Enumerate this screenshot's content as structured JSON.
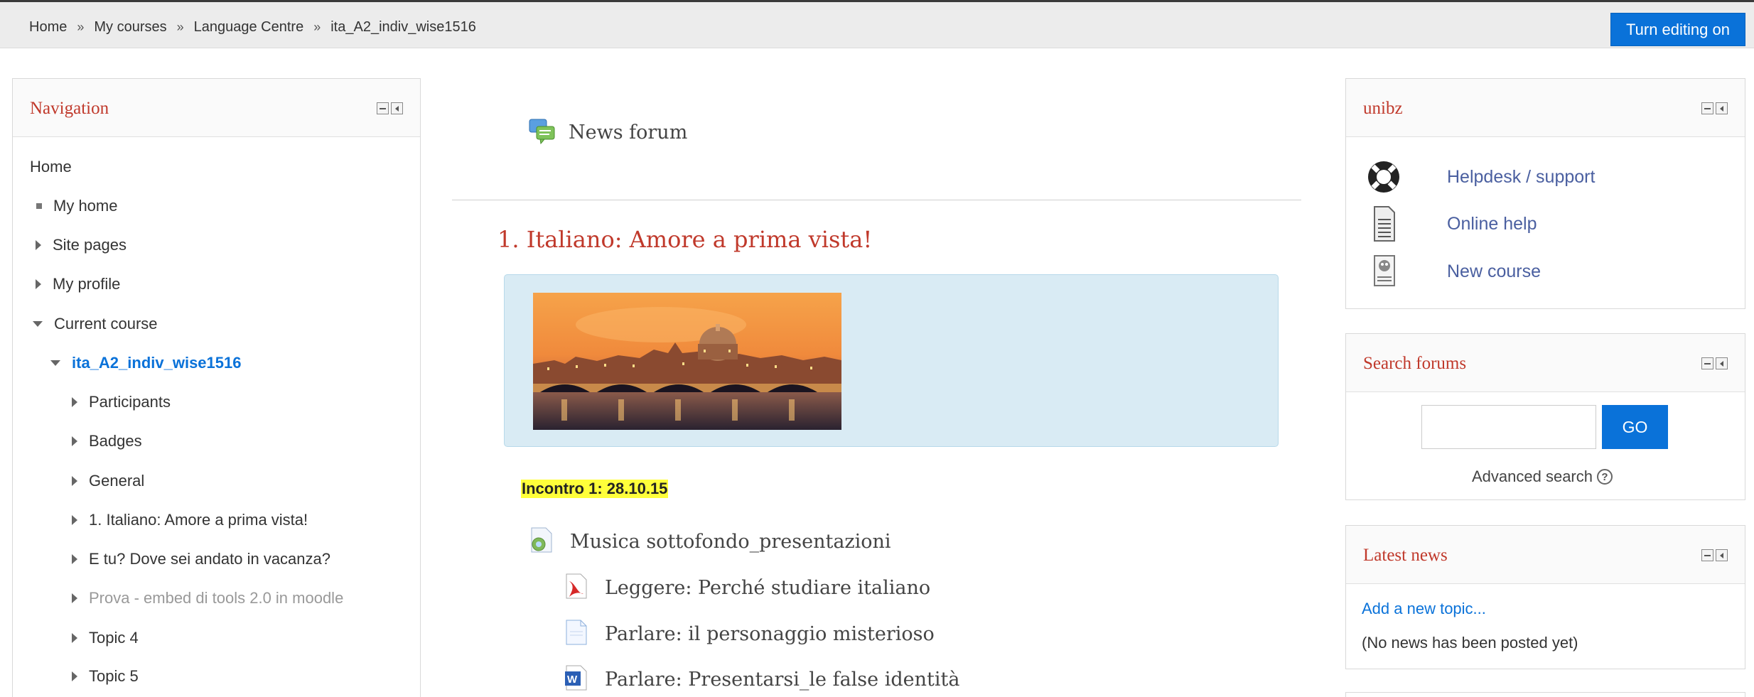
{
  "breadcrumb": {
    "items": [
      "Home",
      "My courses",
      "Language Centre",
      "ita_A2_indiv_wise1516"
    ],
    "separator": "»"
  },
  "header": {
    "edit_button": "Turn editing on"
  },
  "navigation": {
    "title": "Navigation",
    "items": [
      {
        "label": "Home",
        "icon": "none"
      },
      {
        "label": "My home",
        "icon": "bullet"
      },
      {
        "label": "Site pages",
        "icon": "triangle-right"
      },
      {
        "label": "My profile",
        "icon": "triangle-right"
      },
      {
        "label": "Current course",
        "icon": "triangle-down"
      },
      {
        "label": "ita_A2_indiv_wise1516",
        "icon": "triangle-down"
      },
      {
        "label": "Participants",
        "icon": "triangle-right"
      },
      {
        "label": "Badges",
        "icon": "triangle-right"
      },
      {
        "label": "General",
        "icon": "triangle-right"
      },
      {
        "label": "1. Italiano: Amore a prima vista!",
        "icon": "triangle-right"
      },
      {
        "label": "E tu? Dove sei andato in vacanza?",
        "icon": "triangle-right"
      },
      {
        "label": "Prova - embed di tools 2.0 in moodle",
        "icon": "triangle-right"
      },
      {
        "label": "Topic 4",
        "icon": "triangle-right"
      },
      {
        "label": "Topic 5",
        "icon": "triangle-right"
      }
    ]
  },
  "main": {
    "news_forum": "News forum",
    "section_title": "1. Italiano: Amore a prima vista!",
    "meeting_label": "Incontro 1: 28.10.15",
    "activities": [
      {
        "label": "Musica sottofondo_presentazioni",
        "icon": "audio-file-icon"
      },
      {
        "label": "Leggere: Perché studiare italiano",
        "icon": "pdf-icon"
      },
      {
        "label": "Parlare: il personaggio misterioso",
        "icon": "document-icon"
      },
      {
        "label": "Parlare: Presentarsi_le false identità",
        "icon": "word-doc-icon"
      }
    ]
  },
  "unibz": {
    "title": "unibz",
    "links": [
      {
        "label": "Helpdesk / support",
        "icon": "lifebuoy-icon"
      },
      {
        "label": "Online help",
        "icon": "document-icon"
      },
      {
        "label": "New course",
        "icon": "new-course-icon"
      }
    ]
  },
  "search_forums": {
    "title": "Search forums",
    "input_value": "",
    "go_button": "GO",
    "advanced": "Advanced search",
    "help_glyph": "?"
  },
  "latest_news": {
    "title": "Latest news",
    "add_topic": "Add a new topic...",
    "empty": "(No news has been posted yet)"
  },
  "colors": {
    "accent": "#0a72d9",
    "block_title": "#c0392b",
    "summary_bg": "#d9ebf4",
    "highlight": "#ffff3a"
  }
}
